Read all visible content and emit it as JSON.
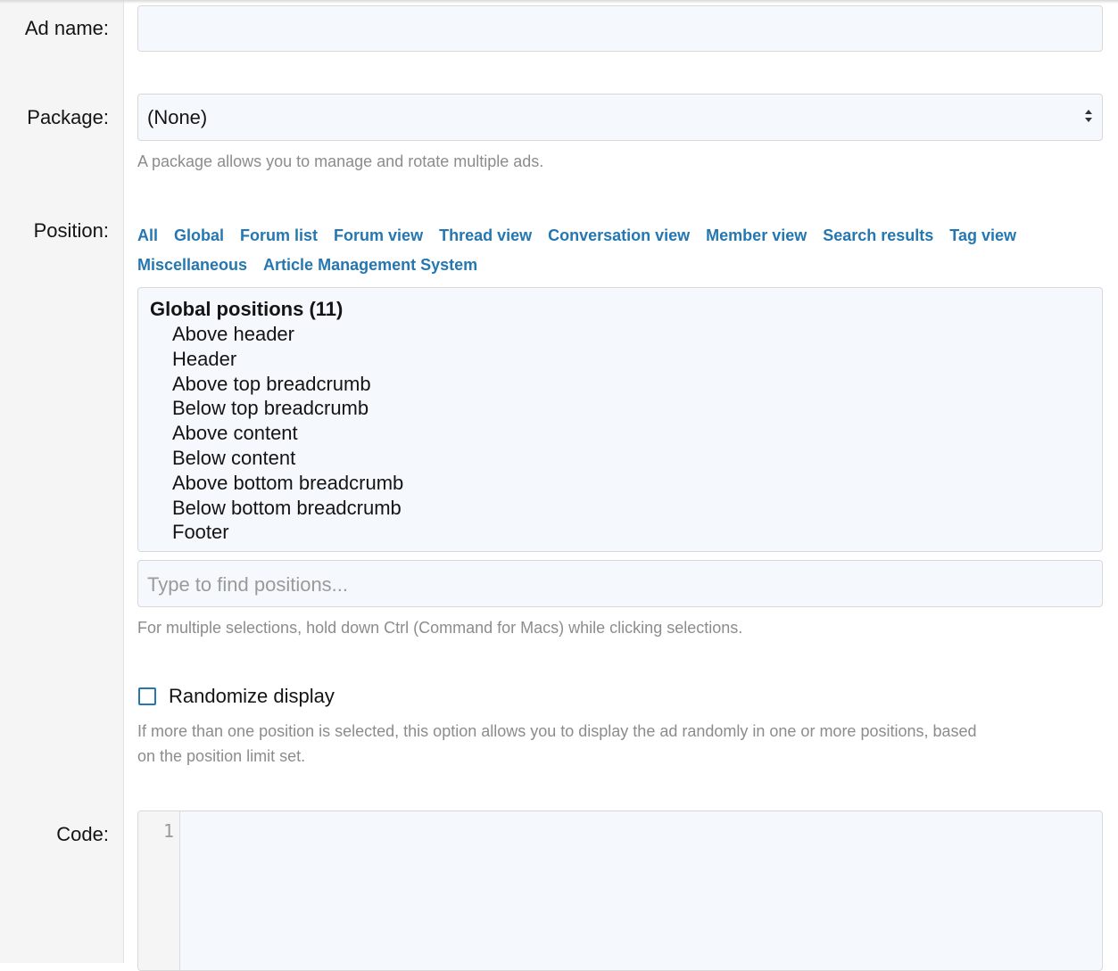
{
  "form": {
    "ad_name": {
      "label": "Ad name:",
      "value": ""
    },
    "package": {
      "label": "Package:",
      "selected": "(None)",
      "explain": "A package allows you to manage and rotate multiple ads."
    },
    "position": {
      "label": "Position:",
      "tabs": [
        "All",
        "Global",
        "Forum list",
        "Forum view",
        "Thread view",
        "Conversation view",
        "Member view",
        "Search results",
        "Tag view",
        "Miscellaneous",
        "Article Management System"
      ],
      "group_title": "Global positions (11)",
      "options": [
        "Above header",
        "Header",
        "Above top breadcrumb",
        "Below top breadcrumb",
        "Above content",
        "Below content",
        "Above bottom breadcrumb",
        "Below bottom breadcrumb",
        "Footer"
      ],
      "find_placeholder": "Type to find positions...",
      "explain": "For multiple selections, hold down Ctrl (Command for Macs) while clicking selections."
    },
    "randomize": {
      "label": "Randomize display",
      "checked": false,
      "explain_line1": "If more than one position is selected, this option allows you to display the ad randomly in one or more positions, based",
      "explain_line2": "on the position limit set."
    },
    "code": {
      "label": "Code:",
      "line_number": "1"
    }
  },
  "colors": {
    "link": "#2577b1",
    "input_bg": "#f5f9fd",
    "label_column_bg": "#f5f5f5",
    "muted_text": "#8c8c8c"
  }
}
